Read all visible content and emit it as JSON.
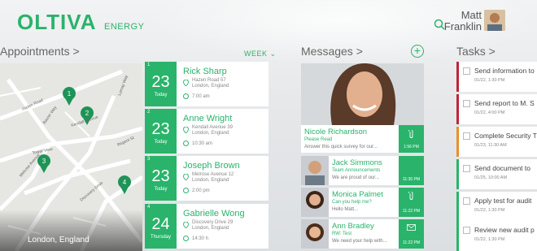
{
  "header": {
    "logo": "OLTIVA",
    "logo_sub": "ENERGY",
    "user_first": "Matt",
    "user_last": "Franklin"
  },
  "sections": {
    "appointments": "Appointments >",
    "messages": "Messages >",
    "tasks": "Tasks >",
    "week": "WEEK"
  },
  "map": {
    "location": "London, England",
    "streets": [
      "Hazen Road",
      "Kendall Avenue",
      "Tower View",
      "Regent St",
      "Melrose Avenue",
      "Discovery Drive",
      "Lomay Way",
      "Baxter Way"
    ],
    "pins": [
      "1",
      "2",
      "3",
      "4"
    ]
  },
  "appointments": [
    {
      "idx": "1",
      "day": "23",
      "dayname": "Today",
      "name": "Rick Sharp",
      "addr1": "Hazen Road 57",
      "addr2": "London, England",
      "time": "7:00 am"
    },
    {
      "idx": "2",
      "day": "23",
      "dayname": "Today",
      "name": "Anne Wright",
      "addr1": "Kendall Avenue 39",
      "addr2": "London, England",
      "time": "10:30 am"
    },
    {
      "idx": "3",
      "day": "23",
      "dayname": "Today",
      "name": "Joseph Brown",
      "addr1": "Melrose Avenue 12",
      "addr2": "London, England",
      "time": "2:00 pm"
    },
    {
      "idx": "4",
      "day": "24",
      "dayname": "Thursday",
      "name": "Gabrielle Wong",
      "addr1": "Discovery Drive 29",
      "addr2": "London, England",
      "time": "14:30 h"
    }
  ],
  "messages": [
    {
      "name": "Nicole Richardson",
      "sub": "Please Read",
      "text": "Answer this quick survey for our...",
      "time": "1:56 PM"
    },
    {
      "name": "Jack Simmons",
      "sub": "Team Announcements",
      "text": "We are proud of our...",
      "time": "11:30 PM"
    },
    {
      "name": "Monica Palmet",
      "sub": "Can you help me?",
      "text": "Hello Matt...",
      "time": "11:22 PM"
    },
    {
      "name": "Ann Bradley",
      "sub": "RW: Test",
      "text": "We need your help with...",
      "time": "11:22 PM"
    }
  ],
  "tasks": [
    {
      "title": "Send information to",
      "date": "01/22, 1:30 PM",
      "color": "#c0243a"
    },
    {
      "title": "Send report to M. S",
      "date": "01/22, 4:00 PM",
      "color": "#c0243a"
    },
    {
      "title": "Complete Security T",
      "date": "01/23, 11:30 AM",
      "color": "#e8902a"
    },
    {
      "title": "Send document to",
      "date": "01/25, 10:00 AM",
      "color": "#2ab36b"
    },
    {
      "title": "Apply test for audit",
      "date": "01/22, 1:30 PM",
      "color": "#2ab36b"
    },
    {
      "title": "Review new audit p",
      "date": "01/22, 1:30 PM",
      "color": "#2ab36b"
    }
  ]
}
